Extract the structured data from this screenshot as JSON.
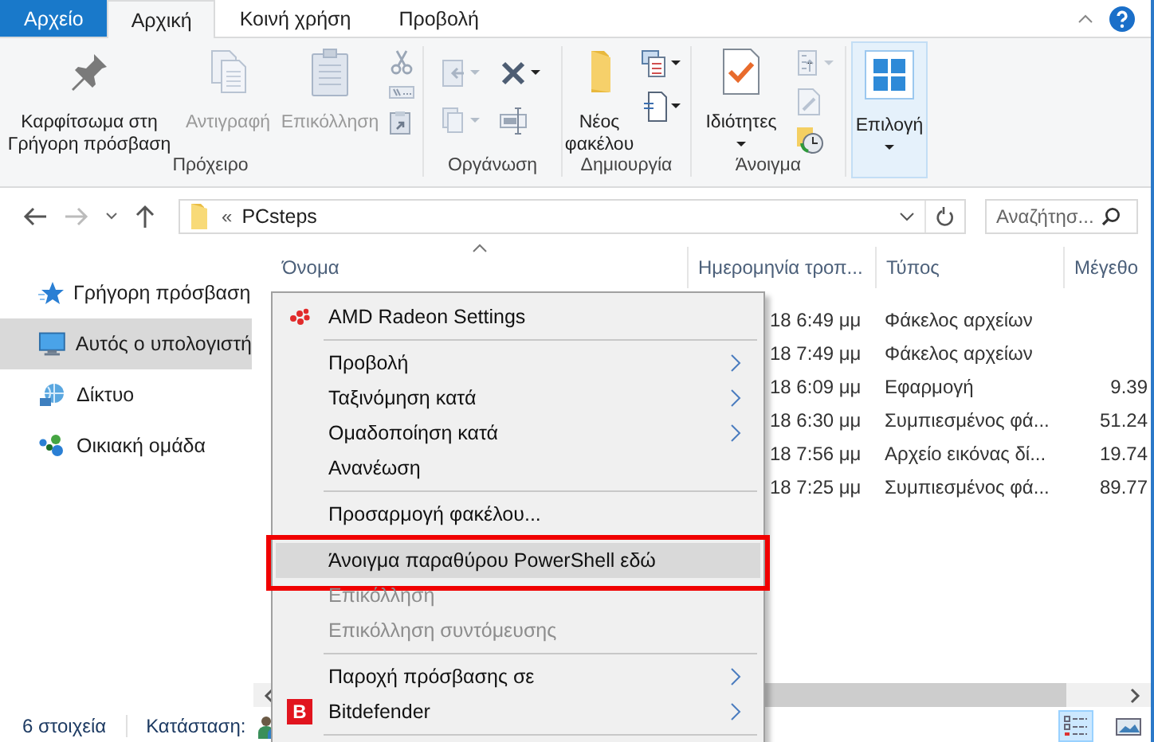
{
  "ribbon": {
    "tabs": [
      {
        "label": "Αρχείο",
        "kind": "file",
        "selected": false
      },
      {
        "label": "Αρχική",
        "kind": "tab",
        "selected": true
      },
      {
        "label": "Κοινή χρήση",
        "kind": "tab",
        "selected": false
      },
      {
        "label": "Προβολή",
        "kind": "tab",
        "selected": false
      }
    ],
    "groups": [
      {
        "label": "Πρόχειρο",
        "buttons": [
          {
            "label": "Καρφίτσωμα στη Γρήγορη πρόσβαση",
            "disabled": false,
            "highlighted": false
          },
          {
            "label": "Αντιγραφή",
            "disabled": true,
            "highlighted": false
          },
          {
            "label": "Επικόλληση",
            "disabled": true,
            "highlighted": false
          }
        ]
      },
      {
        "label": "Οργάνωση"
      },
      {
        "label": "Δημιουργία",
        "buttons": [
          {
            "label": "Νέος φακέλου",
            "disabled": false,
            "highlighted": false
          }
        ]
      },
      {
        "label": "Άνοιγμα",
        "buttons": [
          {
            "label": "Ιδιότητες",
            "disabled": false,
            "highlighted": false
          }
        ]
      },
      {
        "buttons": [
          {
            "label": "Επιλογή",
            "disabled": false,
            "highlighted": true
          }
        ]
      }
    ]
  },
  "address": {
    "prefix": "«",
    "path": "PCsteps"
  },
  "search": {
    "placeholder": "Αναζήτησ..."
  },
  "sidebar": {
    "items": [
      {
        "label": "Γρήγορη πρόσβαση",
        "selected": false
      },
      {
        "label": "Αυτός ο υπολογιστή",
        "selected": true
      },
      {
        "label": "Δίκτυο",
        "selected": false
      },
      {
        "label": "Οικιακή ομάδα",
        "selected": false
      }
    ]
  },
  "table": {
    "columns": [
      "Όνομα",
      "Ημερομηνία τροπ...",
      "Τύπος",
      "Μέγεθο"
    ],
    "rows": [
      {
        "date": "18 6:49 μμ",
        "type": "Φάκελος αρχείων"
      },
      {
        "date": "18 7:49 μμ",
        "type": "Φάκελος αρχείων"
      },
      {
        "date": "18 6:09 μμ",
        "type": "Εφαρμογή",
        "size": "9.39"
      },
      {
        "date": "18 6:30 μμ",
        "type": "Συμπιεσμένος φά...",
        "size": "51.24"
      },
      {
        "date": "18 7:56 μμ",
        "type": "Αρχείο εικόνας δί...",
        "size": "19.74"
      },
      {
        "date": "18 7:25 μμ",
        "type": "Συμπιεσμένος φά...",
        "size": "89.77"
      }
    ]
  },
  "context_menu": {
    "items": [
      {
        "kind": "item",
        "label": "AMD Radeon Settings",
        "disabled": false,
        "selected": false,
        "submenu": false,
        "outlined": false
      },
      {
        "kind": "separator"
      },
      {
        "kind": "item",
        "label": "Προβολή",
        "disabled": false,
        "selected": false,
        "submenu": true,
        "outlined": false
      },
      {
        "kind": "item",
        "label": "Ταξινόμηση κατά",
        "disabled": false,
        "selected": false,
        "submenu": true,
        "outlined": false
      },
      {
        "kind": "item",
        "label": "Ομαδοποίηση κατά",
        "disabled": false,
        "selected": false,
        "submenu": true,
        "outlined": false
      },
      {
        "kind": "item",
        "label": "Ανανέωση",
        "disabled": false,
        "selected": false,
        "submenu": false,
        "outlined": false
      },
      {
        "kind": "separator"
      },
      {
        "kind": "item",
        "label": "Προσαρμογή φακέλου...",
        "disabled": false,
        "selected": false,
        "submenu": false,
        "outlined": false
      },
      {
        "kind": "separator"
      },
      {
        "kind": "item",
        "label": "Άνοιγμα παραθύρου PowerShell εδώ",
        "disabled": false,
        "selected": true,
        "submenu": false,
        "outlined": true
      },
      {
        "kind": "item",
        "label": "Επικόλληση",
        "disabled": true,
        "selected": false,
        "submenu": false,
        "outlined": false
      },
      {
        "kind": "item",
        "label": "Επικόλληση συντόμευσης",
        "disabled": true,
        "selected": false,
        "submenu": false,
        "outlined": false
      },
      {
        "kind": "separator"
      },
      {
        "kind": "item",
        "label": "Παροχή πρόσβασης σε",
        "disabled": false,
        "selected": false,
        "submenu": true,
        "outlined": false
      },
      {
        "kind": "item",
        "label": "Bitdefender",
        "badge": "B",
        "disabled": false,
        "selected": false,
        "submenu": true,
        "outlined": false
      },
      {
        "kind": "separator"
      }
    ]
  },
  "status_bar": {
    "count": "6 στοιχεία",
    "state_label": "Κατάσταση:"
  },
  "view_buttons": [
    {
      "selected": true
    },
    {
      "selected": false
    }
  ]
}
